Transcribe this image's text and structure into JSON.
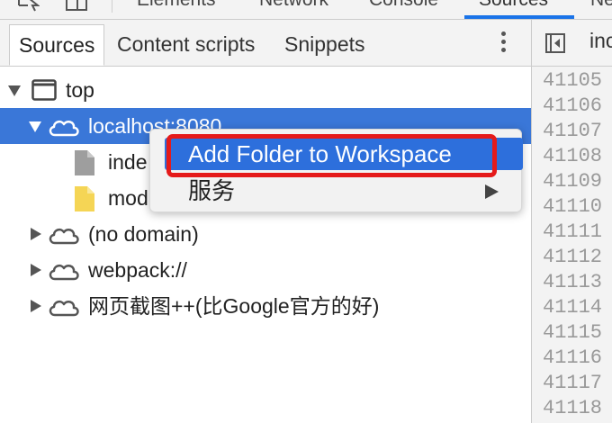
{
  "devtools_tabs": [
    {
      "label": "Elements",
      "active": false
    },
    {
      "label": "Network",
      "active": false
    },
    {
      "label": "Console",
      "active": false
    },
    {
      "label": "Sources",
      "active": true
    },
    {
      "label": "Ne",
      "active": false
    }
  ],
  "navigator": {
    "tabs": [
      {
        "label": "Sources",
        "active": true
      },
      {
        "label": "Content scripts",
        "active": false
      },
      {
        "label": "Snippets",
        "active": false
      }
    ],
    "more_icon": "kebab-menu-icon"
  },
  "tree": {
    "rows": [
      {
        "label": "top",
        "icon": "frame-icon",
        "expanded": true
      },
      {
        "label": "localhost:8080",
        "icon": "cloud-icon",
        "expanded": true,
        "selected": true
      },
      {
        "label": "inde",
        "icon": "file-icon",
        "color": "#9e9e9e"
      },
      {
        "label": "mod",
        "icon": "file-icon",
        "color": "#f5d555"
      },
      {
        "label": "(no domain)",
        "icon": "cloud-icon",
        "expanded": false
      },
      {
        "label": "webpack://",
        "icon": "cloud-icon",
        "expanded": false
      },
      {
        "label": "网页截图++(比Google官方的好)",
        "icon": "cloud-icon",
        "expanded": false
      }
    ]
  },
  "editor": {
    "tab_label": "inc",
    "line_numbers": [
      "41105",
      "41106",
      "41107",
      "41108",
      "41109",
      "41110",
      "41111",
      "41112",
      "41113",
      "41114",
      "41115",
      "41116",
      "41117",
      "41118"
    ]
  },
  "context_menu": {
    "items": [
      {
        "label": "Add Folder to Workspace",
        "highlighted": true
      },
      {
        "label": "服务",
        "has_submenu": true
      }
    ]
  },
  "colors": {
    "selection": "#3a77d8",
    "menu_highlight": "#2d6fdc",
    "annotation": "#e51a1a",
    "accent": "#1a73e8"
  }
}
